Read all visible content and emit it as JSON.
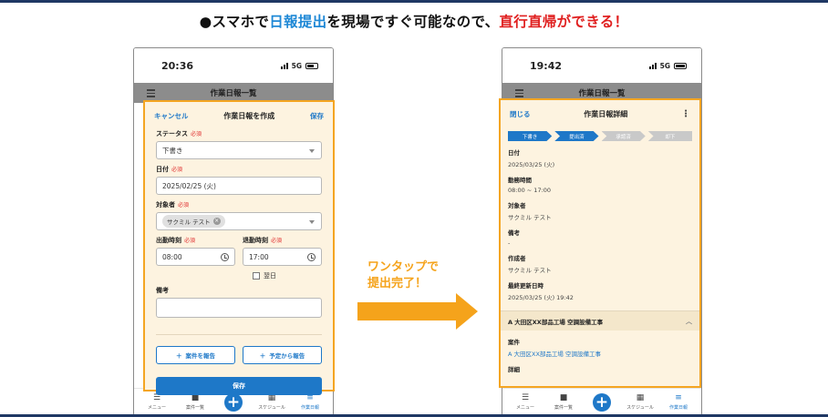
{
  "headline": {
    "part1": "●スマホで",
    "part2": "日報提出",
    "part3": "を現場ですぐ可能なので、",
    "part4": "直行直帰ができる！"
  },
  "annotation": {
    "line1": "ワンタップで",
    "line2": "提出完了！"
  },
  "colors": {
    "accent_blue": "#1e78c8",
    "highlight_orange": "#f4a522",
    "headline_red": "#e02020",
    "headline_blue": "#1e88d6"
  },
  "left_phone": {
    "status": {
      "time": "20:36",
      "network": "5G"
    },
    "appbar_title": "作業日報一覧",
    "form": {
      "cancel": "キャンセル",
      "title": "作業日報を作成",
      "save_link": "保存",
      "required": "必須",
      "status_label": "ステータス",
      "status_value": "下書き",
      "date_label": "日付",
      "date_value": "2025/02/25 (火)",
      "target_label": "対象者",
      "target_chip": "サクミル テスト",
      "start_label": "出勤時刻",
      "start_value": "08:00",
      "end_label": "退勤時刻",
      "end_value": "17:00",
      "next_day": "翌日",
      "note_label": "備考",
      "add_project": "案件を報告",
      "from_schedule": "予定から報告",
      "save_button": "保存"
    },
    "tabs": [
      {
        "label": "メニュー",
        "icon": "menu-icon"
      },
      {
        "label": "案件一覧",
        "icon": "briefcase-icon"
      },
      {
        "label": "",
        "icon": "plus-fab-icon"
      },
      {
        "label": "スケジュール",
        "icon": "calendar-icon"
      },
      {
        "label": "作業日報",
        "icon": "report-icon"
      }
    ]
  },
  "right_phone": {
    "status": {
      "time": "19:42",
      "network": "5G"
    },
    "appbar_title": "作業日報一覧",
    "detail": {
      "close": "閉じる",
      "title": "作業日報詳細",
      "steps": [
        "下書き",
        "提出済",
        "承認済",
        "却下"
      ],
      "current_step_index": 1,
      "date_label": "日付",
      "date_value": "2025/03/25 (火)",
      "hours_label": "勤務時間",
      "hours_value": "08:00 ~ 17:00",
      "target_label": "対象者",
      "target_value": "サクミル テスト",
      "note_label": "備考",
      "note_value": "-",
      "creator_label": "作成者",
      "creator_value": "サクミル テスト",
      "updated_label": "最終更新日時",
      "updated_value": "2025/03/25 (火) 19:42",
      "section_title": "A 大田区XX部品工場 空調設備工事",
      "project_label": "案件",
      "project_value": "A 大田区XX部品工場 空調設備工事",
      "detail_label": "詳細"
    },
    "tabs": [
      {
        "label": "メニュー",
        "icon": "menu-icon"
      },
      {
        "label": "案件一覧",
        "icon": "briefcase-icon"
      },
      {
        "label": "",
        "icon": "plus-fab-icon"
      },
      {
        "label": "スケジュール",
        "icon": "calendar-icon"
      },
      {
        "label": "作業日報",
        "icon": "report-icon"
      }
    ]
  }
}
